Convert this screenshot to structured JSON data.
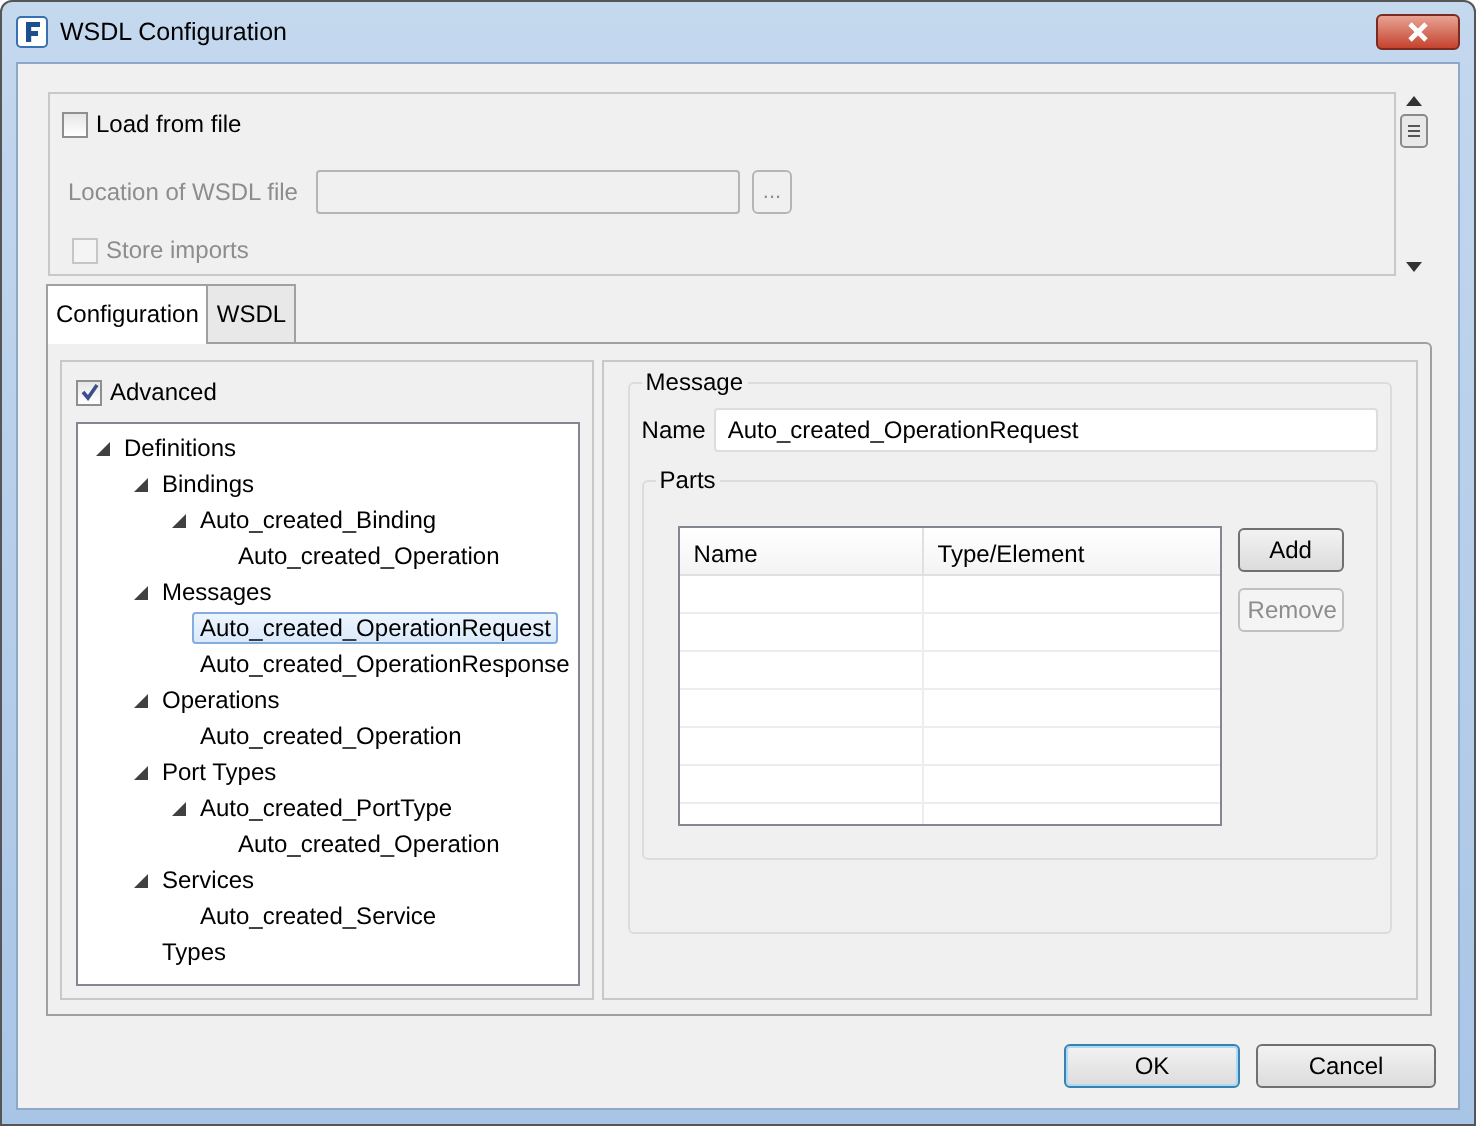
{
  "window": {
    "title": "WSDL Configuration"
  },
  "load_section": {
    "load_from_file": {
      "label": "Load from file",
      "checked": false,
      "disabled": false
    },
    "location": {
      "label": "Location of WSDL file",
      "browse": "...",
      "disabled": true
    },
    "store_imports": {
      "label": "Store imports",
      "checked": false,
      "disabled": true
    }
  },
  "tabs": [
    {
      "label": "Configuration",
      "selected": true
    },
    {
      "label": "WSDL",
      "selected": false
    }
  ],
  "advanced": {
    "label": "Advanced",
    "checked": true
  },
  "tree": [
    {
      "label": "Definitions",
      "expanded": true,
      "selected": false,
      "children": [
        {
          "label": "Bindings",
          "expanded": true,
          "selected": false,
          "children": [
            {
              "label": "Auto_created_Binding",
              "expanded": true,
              "selected": false,
              "children": [
                {
                  "label": "Auto_created_Operation",
                  "selected": false
                }
              ]
            }
          ]
        },
        {
          "label": "Messages",
          "expanded": true,
          "selected": false,
          "children": [
            {
              "label": "Auto_created_OperationRequest",
              "selected": true
            },
            {
              "label": "Auto_created_OperationResponse",
              "selected": false
            }
          ]
        },
        {
          "label": "Operations",
          "expanded": true,
          "selected": false,
          "children": [
            {
              "label": "Auto_created_Operation",
              "selected": false
            }
          ]
        },
        {
          "label": "Port Types",
          "expanded": true,
          "selected": false,
          "children": [
            {
              "label": "Auto_created_PortType",
              "expanded": true,
              "selected": false,
              "children": [
                {
                  "label": "Auto_created_Operation",
                  "selected": false
                }
              ]
            }
          ]
        },
        {
          "label": "Services",
          "expanded": true,
          "selected": false,
          "children": [
            {
              "label": "Auto_created_Service",
              "selected": false
            }
          ]
        },
        {
          "label": "Types",
          "selected": false
        }
      ]
    }
  ],
  "message": {
    "legend": "Message",
    "name_label": "Name",
    "name_value": "Auto_created_OperationRequest",
    "parts": {
      "legend": "Parts",
      "columns": [
        "Name",
        "Type/Element"
      ],
      "buttons": [
        {
          "label": "Add",
          "disabled": false
        },
        {
          "label": "Remove",
          "disabled": true
        }
      ]
    }
  },
  "buttons": [
    {
      "label": "OK",
      "default": true
    },
    {
      "label": "Cancel",
      "default": false
    }
  ]
}
